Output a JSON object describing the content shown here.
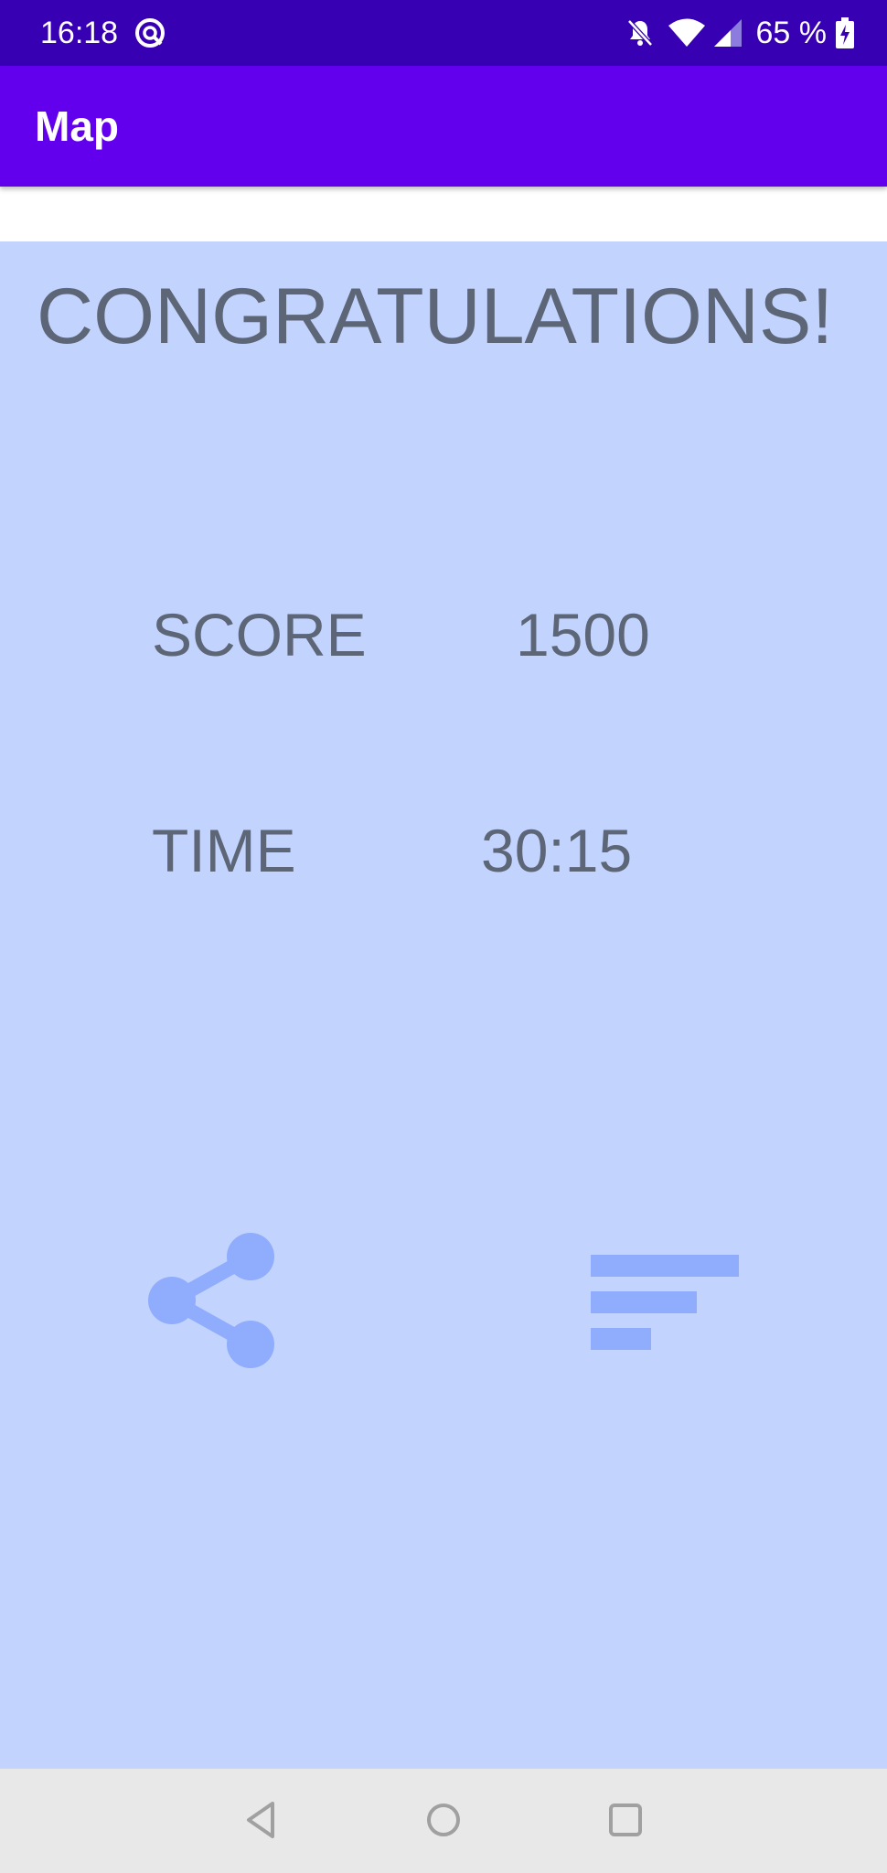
{
  "status_bar": {
    "time": "16:18",
    "battery": "65 %",
    "icons": [
      "app-notification-icon",
      "bell-off-icon",
      "wifi-icon",
      "cellular-signal-icon",
      "battery-charging-icon"
    ]
  },
  "app_bar": {
    "title": "Map"
  },
  "result": {
    "heading": "CONGRATULATIONS!",
    "score_label": "SCORE",
    "score_value": "1500",
    "time_label": "TIME",
    "time_value": "30:15"
  },
  "actions": {
    "share_icon": "share-icon",
    "leaderboard_icon": "sort-icon"
  },
  "nav_bar": {
    "icons": [
      "back-icon",
      "home-icon",
      "recents-icon"
    ]
  },
  "colors": {
    "status_bar": "#3700b3",
    "app_bar": "#6200ee",
    "panel": "#c2d3fe",
    "text": "#5d6677",
    "icon": "#90acfc",
    "nav_bar": "#e8e8e8"
  }
}
